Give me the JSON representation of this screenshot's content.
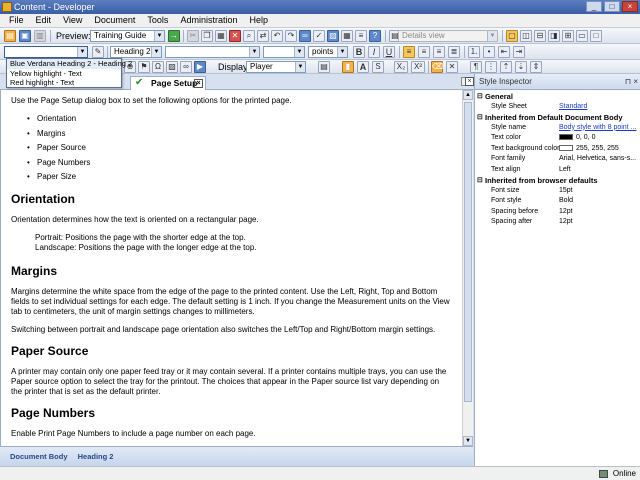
{
  "window": {
    "title": "Content - Developer"
  },
  "menu": [
    "File",
    "Edit",
    "View",
    "Document",
    "Tools",
    "Administration",
    "Help"
  ],
  "toolbar1": {
    "preview_label": "Preview:",
    "preview_value": "Training Guide",
    "view_value": "Details view"
  },
  "toolbar2": {
    "style_value": "",
    "heading_value": "Heading 2",
    "font_value": "",
    "size_value": "",
    "units_value": "points",
    "bold": "B",
    "italic": "I",
    "underline": "U"
  },
  "toolbar3": {
    "display_label": "Display:",
    "display_value": "Player",
    "highlight_letter": "A",
    "subscript": "X₂",
    "superscript": "X²"
  },
  "style_popup": {
    "items": [
      "Blue Verdana Heading 2 - Heading 2",
      "Yellow highlight - Text",
      "Red highlight - Text"
    ]
  },
  "tab": {
    "title": "Page Setup"
  },
  "document": {
    "intro": "Use the Page Setup dialog box to set the following options for the printed page.",
    "bullets": [
      "Orientation",
      "Margins",
      "Paper Source",
      "Page Numbers",
      "Paper Size"
    ],
    "orientation_heading": "Orientation",
    "orientation_text": "Orientation determines how the text is oriented on a rectangular page.",
    "portrait_text": "Portrait: Positions the page with the shorter edge at the top.",
    "landscape_text": "Landscape: Positions the page with the longer edge at the top.",
    "margins_heading": "Margins",
    "margins_text": "Margins determine the white space from the edge of the page to the printed content. Use the Left, Right, Top and Bottom fields to set individual settings for each edge. The default setting is 1 inch. If you change the Measurement units on the View tab to centimeters, the unit of margin settings changes to millimeters.",
    "margins_text2": "Switching between portrait and landscape page orientation also switches the Left/Top and Right/Bottom margin settings.",
    "paper_heading": "Paper Source",
    "paper_text": "A printer may contain only one paper feed tray or it may contain several. If a printer contains multiple trays, you can use the Paper source option to select the tray for the printout. The choices that appear in the Paper source list vary depending on the printer that is set as the default printer.",
    "pagenum_heading": "Page Numbers",
    "pagenum_text": "Enable Print Page Numbers to include a page number on each page."
  },
  "status_strip": {
    "item1": "Document Body",
    "item2": "Heading 2"
  },
  "inspector": {
    "title": "Style Inspector",
    "general_label": "General",
    "stylesheet_key": "Style Sheet",
    "stylesheet_val": "Standard",
    "inherited_doc_label": "Inherited from Default Document Body",
    "style_name_key": "Style name",
    "style_name_val": "Body style with 8 point ...",
    "text_color_key": "Text color",
    "text_color_val": "0, 0, 0",
    "text_bg_key": "Text background color",
    "text_bg_val": "255, 255, 255",
    "font_family_key": "Font family",
    "font_family_val": "Arial, Helvetica, sans-s...",
    "text_align_key": "Text align",
    "text_align_val": "Left",
    "inherited_browser_label": "Inherited from browser defaults",
    "font_size_key": "Font size",
    "font_size_val": "15pt",
    "font_style_key": "Font style",
    "font_style_val": "Bold",
    "spacing_before_key": "Spacing before",
    "spacing_before_val": "12pt",
    "spacing_after_key": "Spacing after",
    "spacing_after_val": "12pt",
    "text_color_swatch": "#000000",
    "text_bg_swatch": "#ffffff"
  },
  "bottombar": {
    "status": "Online"
  }
}
